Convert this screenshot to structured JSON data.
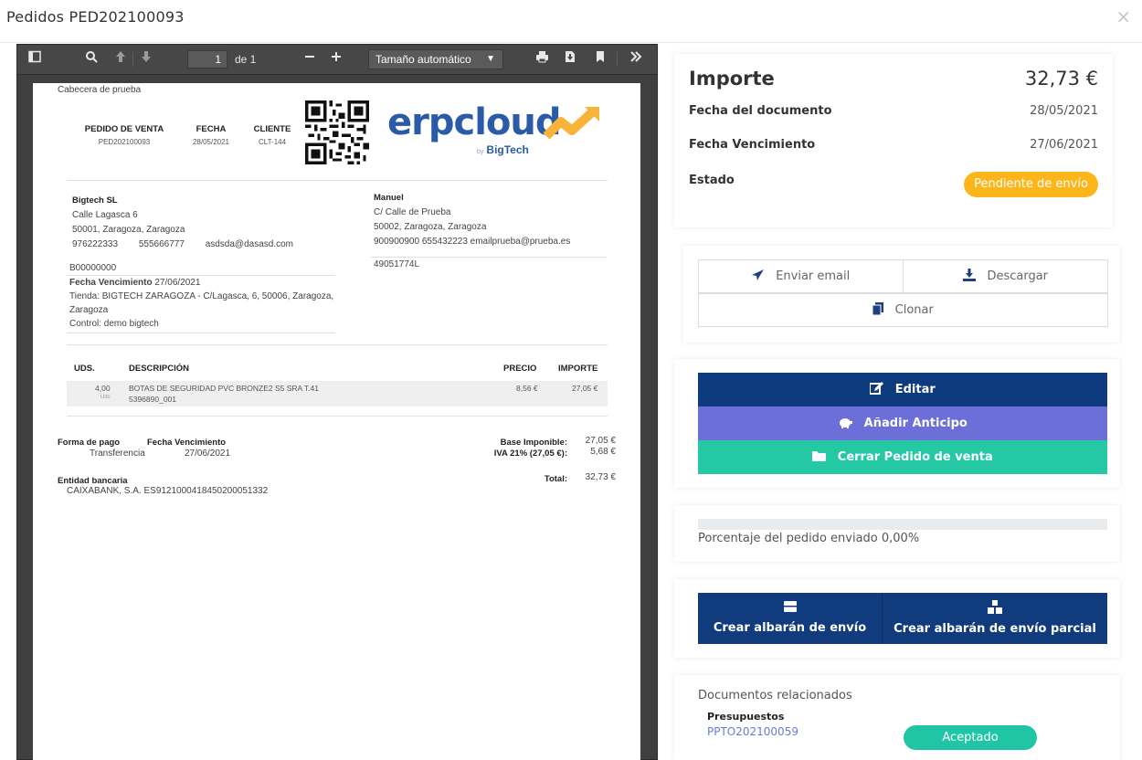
{
  "modal": {
    "title": "Pedidos PED202100093",
    "close_glyph": "×"
  },
  "toolbar": {
    "page_current": "1",
    "page_of": "de 1",
    "zoom_label": "Tamaño automático",
    "icons": [
      "sidebar-toggle-icon",
      "search-icon",
      "previous-page-icon",
      "next-page-icon",
      "zoom-out-icon",
      "zoom-in-icon",
      "print-icon",
      "download-icon",
      "bookmark-icon",
      "more-tools-icon"
    ]
  },
  "pdf": {
    "header_text": "Cabecera de prueba",
    "head_cols": [
      {
        "label": "PEDIDO DE VENTA",
        "value": "PED202100093"
      },
      {
        "label": "FECHA",
        "value": "28/05/2021"
      },
      {
        "label": "CLIENTE",
        "value": "CLT-144"
      }
    ],
    "logo": {
      "main": "erpcloud",
      "by": "by",
      "brand": "BigTech"
    },
    "issuer": {
      "name": "Bigtech SL",
      "street": "Calle Lagasca 6",
      "city": "50001, Zaragoza, Zaragoza",
      "phone1": "976222333",
      "phone2": "555666777",
      "email": "asdsda@dasasd.com",
      "code": "B00000000",
      "due_label": "Fecha Vencimiento",
      "due_value": "27/06/2021",
      "store": "Tienda: BIGTECH ZARAGOZA - C/Lagasca, 6, 50006, Zaragoza,",
      "store2": "Zaragoza",
      "control": "Control: demo bigtech"
    },
    "customer": {
      "name": "Manuel",
      "street": "C/ Calle de Prueba",
      "city": "50002, Zaragoza, Zaragoza",
      "phones": "900900900  655432223   emailprueba@prueba.es",
      "nif": "49051774L"
    },
    "lines_header": {
      "uds": "UDS.",
      "desc": "DESCRIPCIÓN",
      "price": "PRECIO",
      "amount": "IMPORTE"
    },
    "lines": [
      {
        "qty": "4,00",
        "unit": "Uds",
        "desc": "BOTAS DE SEGURIDAD PVC BRONZE2 S5 SRA T.41",
        "ref": "5396890_001",
        "price": "8,56 €",
        "amount": "27,05 €"
      }
    ],
    "payment": {
      "method_label": "Forma de pago",
      "method_value": "Transferencia",
      "due_label": "Fecha Vencimiento",
      "due_value": "27/06/2021",
      "bank_label": "Entidad bancaria",
      "bank_value": "CAIXABANK, S.A. ES9121000418450200051332"
    },
    "totals": {
      "base_label": "Base Imponible:",
      "base_value": "27,05 €",
      "iva_label": "IVA 21% (27,05 €):",
      "iva_value": "5,68 €",
      "total_label": "Total:",
      "total_value": "32,73 €"
    }
  },
  "summary": {
    "title": "Importe",
    "amount": "32,73 €",
    "doc_date_label": "Fecha del documento",
    "doc_date_value": "28/05/2021",
    "due_label": "Fecha Vencimiento",
    "due_value": "27/06/2021",
    "status_label": "Estado",
    "status_value": "Pendiente de envío",
    "status_color": "#fcb61a"
  },
  "actions": {
    "email": "Enviar email",
    "download": "Descargar",
    "clone": "Clonar"
  },
  "main_actions": {
    "edit": "Editar",
    "advance": "Añadir Anticipo",
    "close": "Cerrar Pedido de venta",
    "colors": {
      "edit": "#0e3b7e",
      "advance": "#6c6fd8",
      "close": "#24c8a4"
    }
  },
  "progress": {
    "label": "Porcentaje del pedido enviado 0,00%",
    "percent": 0
  },
  "shipping": {
    "create": "Crear albarán de envío",
    "create_partial": "Crear albarán de envío parcial"
  },
  "related": {
    "title": "Documentos relacionados",
    "group": "Presupuestos",
    "link": "PPTO202100059",
    "status": "Aceptado",
    "status_color": "#20c5a5"
  }
}
